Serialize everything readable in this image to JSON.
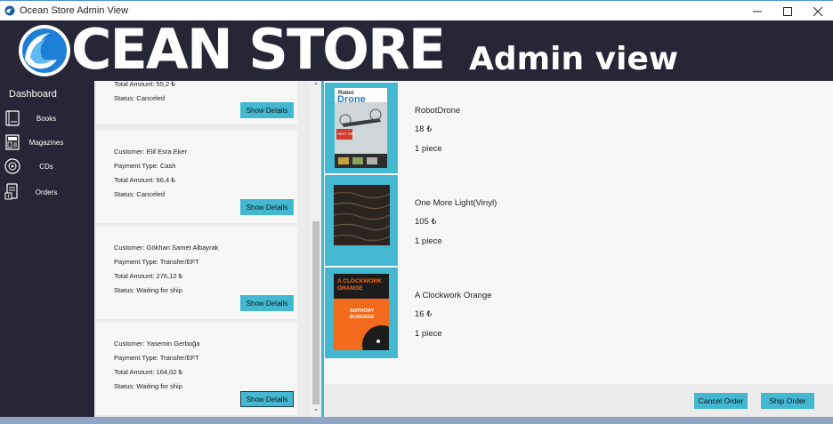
{
  "window": {
    "title": "Ocean Store Admin View"
  },
  "banner": {
    "brand": "CEAN STORE",
    "subtitle": "Admin view"
  },
  "sidebar": {
    "title": "Dashboard",
    "items": [
      {
        "label": "Books",
        "icon": "book-icon"
      },
      {
        "label": "Magazines",
        "icon": "magazine-icon"
      },
      {
        "label": "CDs",
        "icon": "cd-icon"
      },
      {
        "label": "Orders",
        "icon": "orders-icon"
      }
    ]
  },
  "orders": [
    {
      "customer": "",
      "payment": "",
      "total": "Total Amount: 55,2 ₺",
      "status": "Status: Canceled",
      "button": "Show Details"
    },
    {
      "customer": "Customer: Elif Esra Eker",
      "payment": "Payment Type: Cash",
      "total": "Total Amount: 66,4 ₺",
      "status": "Status: Canceled",
      "button": "Show Details"
    },
    {
      "customer": "Customer: Gökhan Samet Albayrak",
      "payment": "Payment Type: Transfer/EFT",
      "total": "Total Amount: 276,12 ₺",
      "status": "Status: Waiting for ship",
      "button": "Show Details"
    },
    {
      "customer": "Customer: Yasemin Gerboğa",
      "payment": "Payment Type: Transfer/EFT",
      "total": "Total Amount: 164,02 ₺",
      "status": "Status: Waiting for ship",
      "button": "Show Details"
    }
  ],
  "products": [
    {
      "name": "RobotDrone",
      "price": "18 ₺",
      "qty": "1 piece",
      "cover_title": "Robot Drone"
    },
    {
      "name": "One More Light(Vinyl)",
      "price": "105 ₺",
      "qty": "1 piece"
    },
    {
      "name": "A Clockwork Orange",
      "price": "16 ₺",
      "qty": "1 piece",
      "cover_title": "A CLOCKWORK ORANGE",
      "cover_author": "ANTHONY BURGESS"
    }
  ],
  "actions": {
    "cancel": "Cancel Order",
    "ship": "Ship Order"
  },
  "colors": {
    "accent": "#45b8d1",
    "dark": "#262636",
    "panel": "#f7f7f7"
  }
}
